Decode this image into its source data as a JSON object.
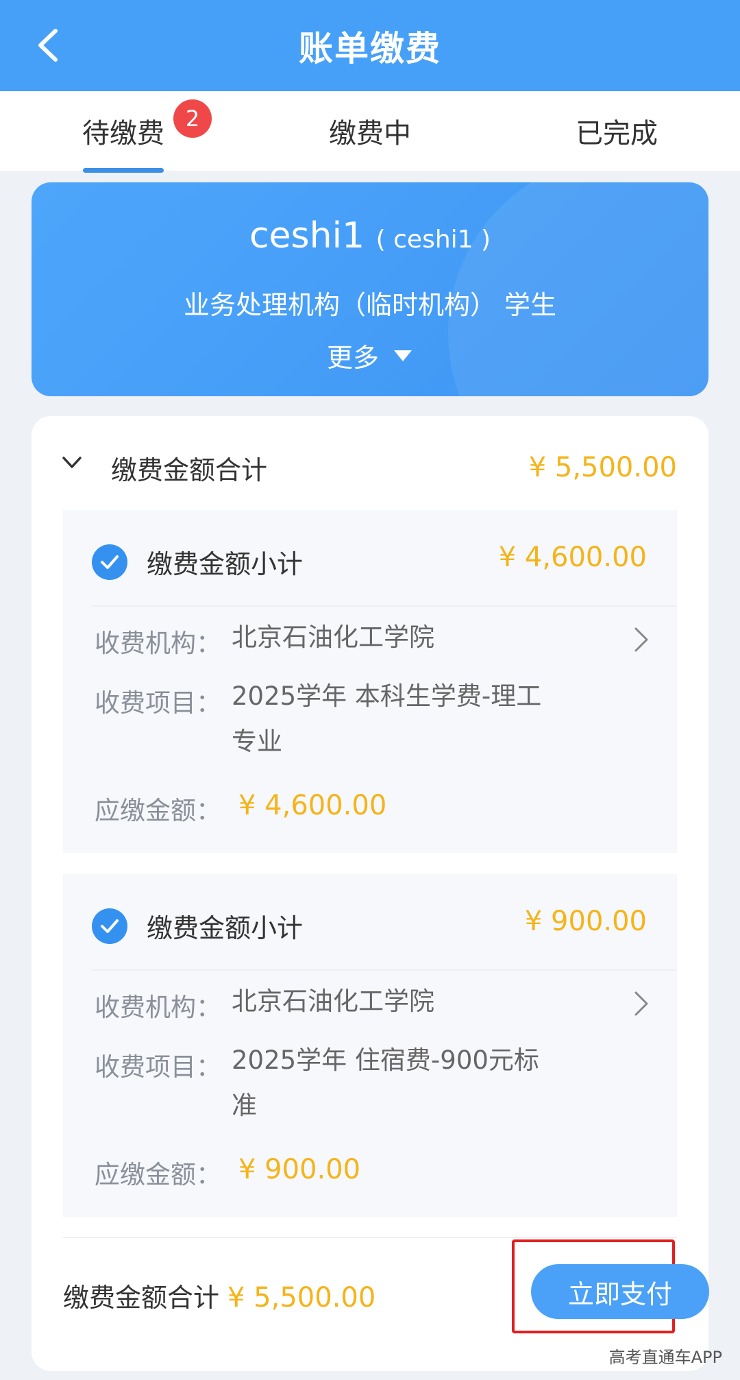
{
  "header": {
    "title": "账单缴费"
  },
  "tabs": [
    {
      "label": "待缴费",
      "badge": "2",
      "active": true
    },
    {
      "label": "缴费中"
    },
    {
      "label": "已完成"
    }
  ],
  "user": {
    "name": "ceshi1",
    "account": "( ceshi1 )",
    "org": "业务处理机构（临时机构） 学生",
    "more_label": "更多"
  },
  "summary": {
    "label": "缴费金额合计",
    "amount": "¥ 5,500.00"
  },
  "items": [
    {
      "subtotal_label": "缴费金额小计",
      "subtotal_amount": "¥ 4,600.00",
      "org_label": "收费机构：",
      "org_value": "北京石油化工学院",
      "project_label": "收费项目：",
      "project_value": "2025学年 本科生学费-理工专业",
      "due_label": "应缴金额：",
      "due_amount": "¥ 4,600.00",
      "checked": true
    },
    {
      "subtotal_label": "缴费金额小计",
      "subtotal_amount": "¥ 900.00",
      "org_label": "收费机构：",
      "org_value": "北京石油化工学院",
      "project_label": "收费项目：",
      "project_value": "2025学年 住宿费-900元标准",
      "due_label": "应缴金额：",
      "due_amount": "¥ 900.00",
      "checked": true
    }
  ],
  "footer": {
    "total_label": "缴费金额合计",
    "total_amount": "¥ 5,500.00",
    "pay_button": "立即支付"
  },
  "watermark": "高考直通车APP",
  "colors": {
    "primary": "#46a0f8",
    "amount": "#f4b41a",
    "badge": "#f04848",
    "highlight": "#e02020"
  }
}
